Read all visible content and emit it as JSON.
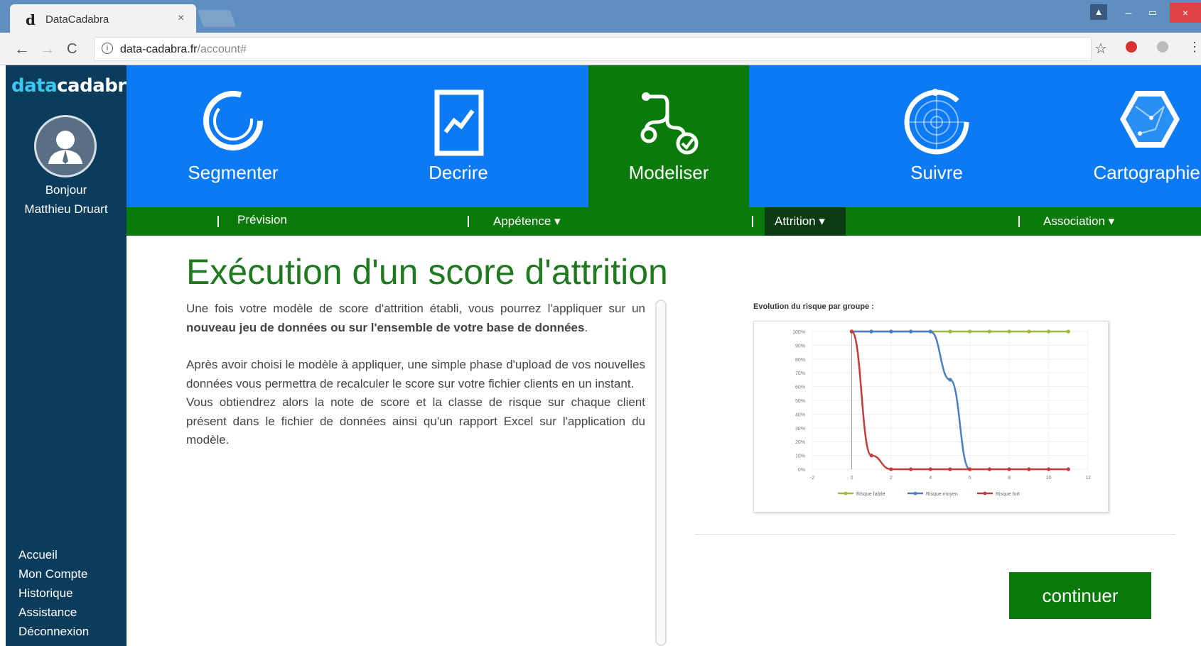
{
  "browser": {
    "tab_title": "DataCadabra",
    "tab_close": "×",
    "favicon": "d",
    "url_host": "data-cadabra.fr",
    "url_path": "/account#",
    "back_glyph": "←",
    "forward_glyph": "→",
    "reload_glyph": "C",
    "info_glyph": "i",
    "star_glyph": "☆",
    "menu_glyph": "⋮",
    "min_glyph": "–",
    "max_glyph": "▭",
    "close_glyph": "×",
    "profile_glyph": "▲"
  },
  "sidebar": {
    "logo_part1": "data",
    "logo_part2": "cadabra",
    "greeting_line1": "Bonjour",
    "greeting_line2": "Matthieu Druart",
    "menu": [
      "Accueil",
      "Mon Compte",
      "Historique",
      "Assistance",
      "Déconnexion"
    ]
  },
  "tiles": [
    {
      "label": "Segmenter",
      "icon": "segment-ring-icon"
    },
    {
      "label": "Decrire",
      "icon": "chart-document-icon"
    },
    {
      "label": "Modeliser",
      "icon": "model-path-icon",
      "active": true
    },
    {
      "label": "Suivre",
      "icon": "radar-icon"
    },
    {
      "label": "Cartographier",
      "icon": "hexagon-map-icon"
    }
  ],
  "subnav": {
    "prevision": "Prévision",
    "appetence": "Appétence ▾",
    "attrition": "Attrition ▾",
    "association": "Association ▾"
  },
  "main": {
    "title": "Exécution d'un score d'attrition",
    "p1_a": "Une fois votre modèle de score d'attrition établi, vous pourrez l'appliquer sur un ",
    "p1_b": "nouveau jeu de données ou sur l'ensemble de votre base de données",
    "p1_c": ".",
    "p2": "Après avoir choisi le modèle à appliquer, une simple phase d'upload de vos nouvelles données vous permettra de recalculer le score sur votre fichier clients en un instant.",
    "p3": "Vous obtiendrez alors la note de score et la classe de risque sur chaque client présent dans le fichier de données ainsi qu'un rapport Excel sur l'application du modèle.",
    "continue_label": "continuer"
  },
  "colors": {
    "brand_blue": "#0d7af5",
    "brand_green": "#0a7a0a",
    "sidebar": "#0c3c5c",
    "title_green": "#1f7a1f",
    "series_low": "#9bbb3b",
    "series_mid": "#4a7ec4",
    "series_high": "#c43b3b"
  },
  "chart_data": {
    "type": "line",
    "title": "Evolution du risque par groupe :",
    "xlim": [
      -2,
      12
    ],
    "ylim": [
      0,
      100
    ],
    "x_ticks": [
      -2,
      0,
      2,
      4,
      6,
      8,
      10,
      12
    ],
    "y_ticks": [
      "0%",
      "10%",
      "20%",
      "30%",
      "40%",
      "50%",
      "60%",
      "70%",
      "80%",
      "90%",
      "100%"
    ],
    "series": [
      {
        "name": "Risque faible",
        "color": "#9bbb3b",
        "x": [
          0,
          1,
          2,
          3,
          4,
          5,
          6,
          7,
          8,
          9,
          10,
          11
        ],
        "y": [
          100,
          100,
          100,
          100,
          100,
          100,
          100,
          100,
          100,
          100,
          100,
          100
        ]
      },
      {
        "name": "Risque moyen",
        "color": "#4a7ec4",
        "x": [
          0,
          1,
          2,
          3,
          4,
          5,
          6
        ],
        "y": [
          100,
          100,
          100,
          100,
          100,
          65,
          0
        ]
      },
      {
        "name": "Risque fort",
        "color": "#c43b3b",
        "x": [
          0,
          1,
          2,
          3,
          4,
          5,
          6,
          7,
          8,
          9,
          10,
          11
        ],
        "y": [
          100,
          10,
          0,
          0,
          0,
          0,
          0,
          0,
          0,
          0,
          0,
          0
        ]
      }
    ]
  }
}
